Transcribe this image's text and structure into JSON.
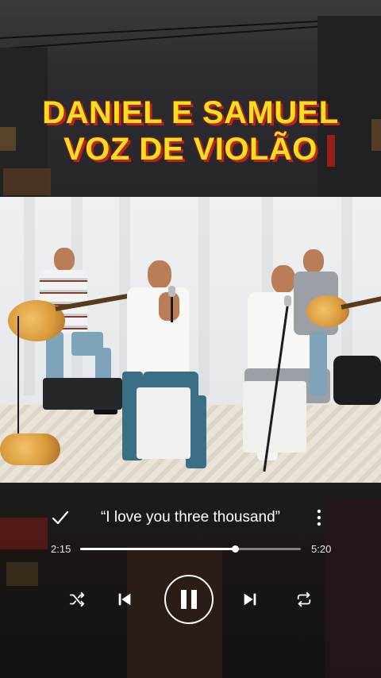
{
  "title": {
    "line1": "DANIEL E SAMUEL",
    "line2": "VOZ DE VIOLÃO"
  },
  "player": {
    "lyric": "“I love you three thousand”",
    "current_time": "2:15",
    "total_time": "5:20",
    "progress": 0.7
  },
  "icons": {
    "check": "check-icon",
    "more": "more-vertical-icon",
    "shuffle": "shuffle-icon",
    "previous": "skip-previous-icon",
    "pause": "pause-icon",
    "next": "skip-next-icon",
    "repeat": "repeat-icon"
  },
  "colors": {
    "title_fill": "#f6df1d",
    "title_outline": "#c02018",
    "controls": "#ffffff"
  }
}
